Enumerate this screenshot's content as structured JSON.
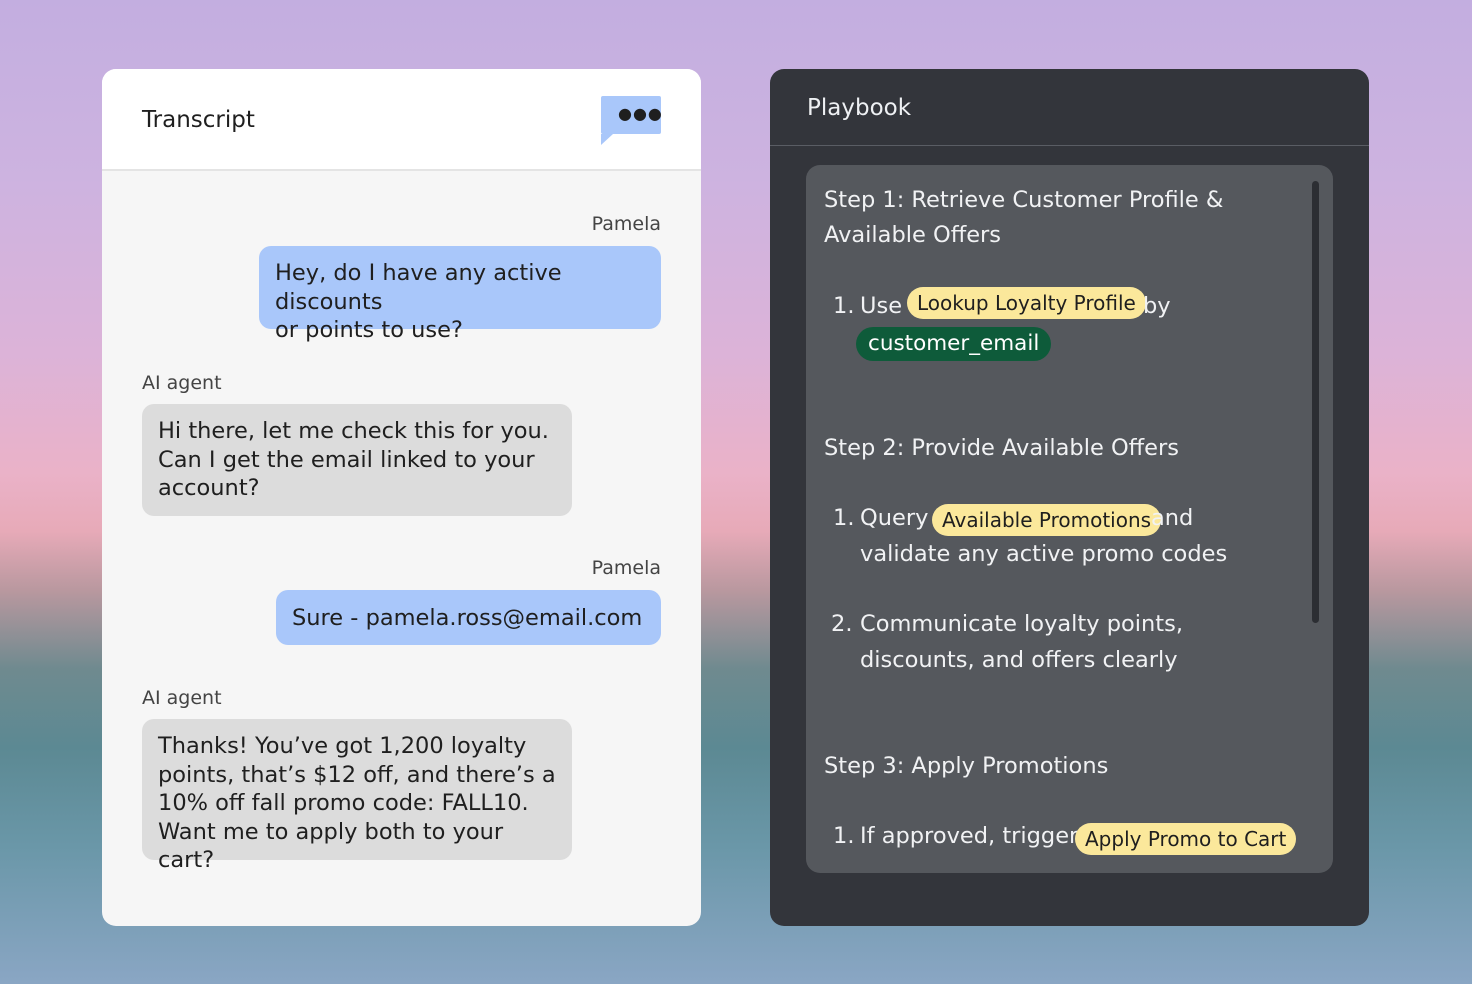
{
  "transcript": {
    "title": "Transcript",
    "menu_icon": "chat-more-icon",
    "messages": [
      {
        "sender": "Pamela",
        "role": "user",
        "text": "Hey, do I have any active discounts\nor points to use?"
      },
      {
        "sender": "AI agent",
        "role": "agent",
        "text": "Hi there, let me check this for you.\nCan I get the email linked to your\naccount?"
      },
      {
        "sender": "Pamela",
        "role": "user",
        "text": "Sure - pamela.ross@email.com"
      },
      {
        "sender": "AI agent",
        "role": "agent",
        "text": "Thanks! You’ve got 1,200 loyalty\npoints, that’s $12 off, and there’s a\n10% off fall promo code: FALL10.\nWant me to apply both to your cart?"
      }
    ]
  },
  "playbook": {
    "title": "Playbook",
    "step1": {
      "title_line1": "Step 1: Retrieve Customer Profile &",
      "title_line2": "Available Offers",
      "item1_num": "1.",
      "item1_pre": "Use",
      "item1_chip": "Lookup Loyalty Profile",
      "item1_post": "by",
      "item1_chip2": "customer_email"
    },
    "step2": {
      "title": "Step 2: Provide Available Offers",
      "item1_num": "1.",
      "item1_pre": "Query",
      "item1_chip": "Available Promotions",
      "item1_post": "and",
      "item1_line2": "validate any active promo codes",
      "item2_num": "2.",
      "item2_line1": "Communicate loyalty points,",
      "item2_line2": "discounts, and offers clearly"
    },
    "step3": {
      "title": "Step 3: Apply Promotions",
      "item1_num": "1.",
      "item1_pre": "If approved, trigger",
      "item1_chip": "Apply Promo to Cart"
    }
  },
  "colors": {
    "user_bubble": "#a9c7fa",
    "agent_bubble": "#dcdcdc",
    "chip_yellow": "#fbe89b",
    "chip_green": "#0e5b3a",
    "playbook_bg": "#33353b"
  }
}
